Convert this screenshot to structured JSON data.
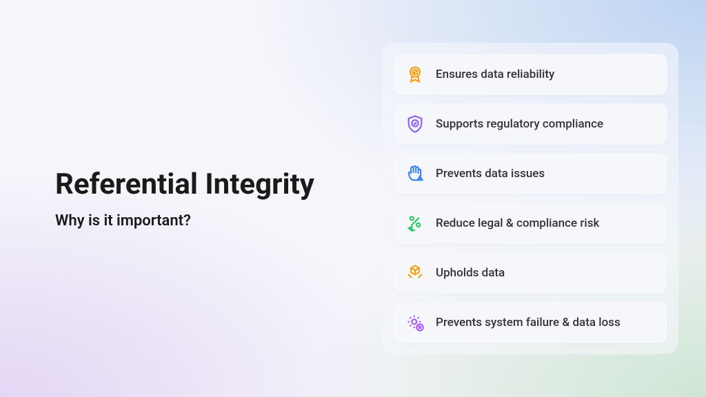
{
  "heading": {
    "title": "Referential Integrity",
    "subtitle": "Why is it important?"
  },
  "cards": [
    {
      "label": "Ensures data reliability"
    },
    {
      "label": "Supports regulatory compliance"
    },
    {
      "label": "Prevents data issues"
    },
    {
      "label": "Reduce legal & compliance risk"
    },
    {
      "label": "Upholds data"
    },
    {
      "label": "Prevents system failure & data loss"
    }
  ],
  "colors": {
    "orange": "#f59e0b",
    "purple": "#8b5cf6",
    "blue": "#3b82f6",
    "green": "#22c55e",
    "violet": "#a855f7"
  }
}
